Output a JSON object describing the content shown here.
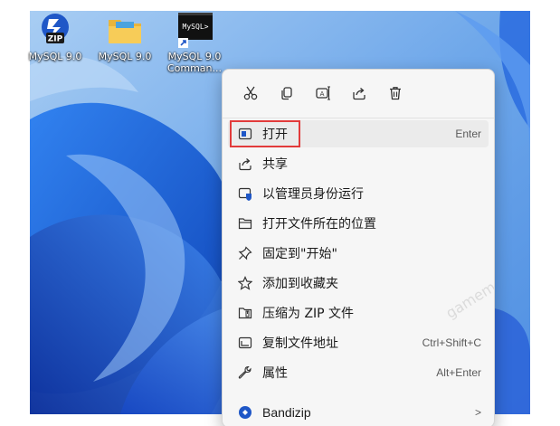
{
  "desktop": {
    "icons": [
      {
        "label": "MySQL 9.0",
        "badge": "ZIP",
        "icon": "winzip-archive-icon"
      },
      {
        "label": "MySQL 9.0",
        "icon": "folder-icon"
      },
      {
        "label_line1": "MySQL 9.0",
        "label_line2": "Comman...",
        "screen_text": "MySQL>",
        "icon": "mysql-command-line-shortcut-icon"
      }
    ]
  },
  "context_menu": {
    "quick_actions": [
      {
        "icon": "cut-icon"
      },
      {
        "icon": "copy-icon"
      },
      {
        "icon": "rename-icon"
      },
      {
        "icon": "share-icon"
      },
      {
        "icon": "delete-icon"
      }
    ],
    "items": [
      {
        "label": "打开",
        "shortcut": "Enter",
        "icon": "open-icon",
        "highlighted": true
      },
      {
        "label": "共享",
        "shortcut": "",
        "icon": "share-icon"
      },
      {
        "label": "以管理员身份运行",
        "shortcut": "",
        "icon": "run-as-admin-icon"
      },
      {
        "label": "打开文件所在的位置",
        "shortcut": "",
        "icon": "folder-open-icon"
      },
      {
        "label": "固定到\"开始\"",
        "shortcut": "",
        "icon": "pin-icon"
      },
      {
        "label": "添加到收藏夹",
        "shortcut": "",
        "icon": "star-icon"
      },
      {
        "label": "压缩为 ZIP 文件",
        "shortcut": "",
        "icon": "zip-icon"
      },
      {
        "label": "复制文件地址",
        "shortcut": "Ctrl+Shift+C",
        "icon": "copy-path-icon"
      },
      {
        "label": "属性",
        "shortcut": "Alt+Enter",
        "icon": "properties-icon"
      },
      {
        "label": "Bandizip",
        "shortcut": "",
        "icon": "bandizip-icon",
        "submenu_arrow": ">"
      }
    ]
  },
  "watermark": "gamemanage",
  "colors": {
    "highlight_outline": "#e23b3b",
    "menu_background": "#f6f6f6",
    "wallpaper_blue": "#1d5fd6"
  }
}
